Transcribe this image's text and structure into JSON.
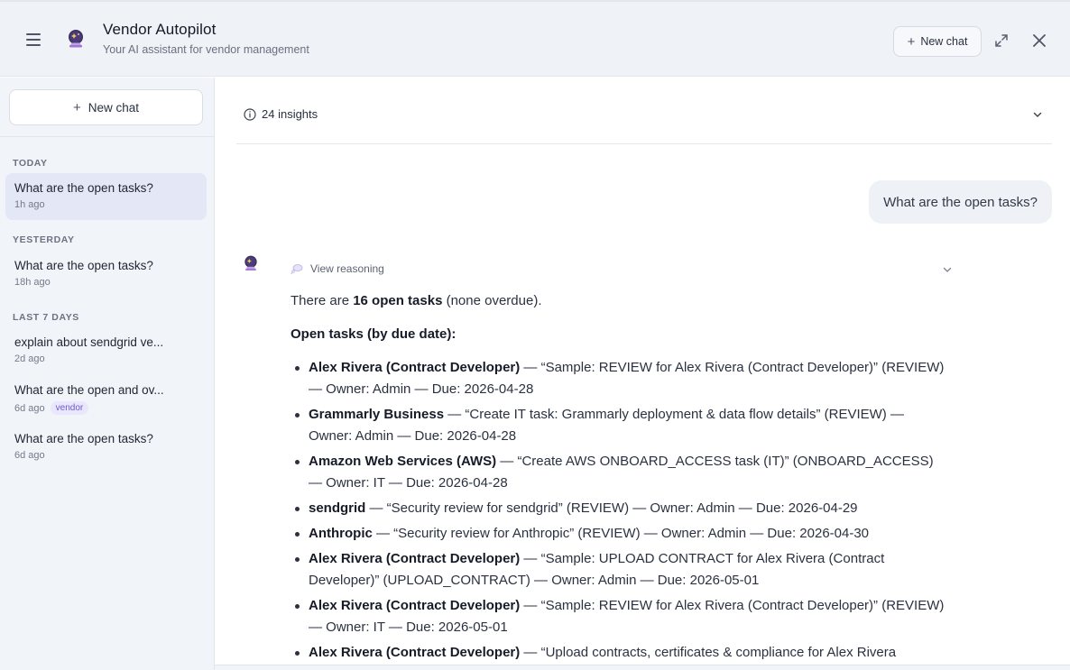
{
  "header": {
    "title": "Vendor Autopilot",
    "subtitle": "Your AI assistant for vendor management",
    "new_chat_label": "New chat"
  },
  "sidebar": {
    "new_chat_label": "New chat",
    "sections": [
      {
        "label": "TODAY"
      },
      {
        "label": "YESTERDAY"
      },
      {
        "label": "LAST 7 DAYS"
      }
    ],
    "conversations": [
      {
        "title": "What are the open tasks?",
        "time": "1h ago",
        "active": true
      },
      {
        "title": "What are the open tasks?",
        "time": "18h ago"
      },
      {
        "title": "explain about sendgrid ve...",
        "time": "2d ago"
      },
      {
        "title": "What are the open and ov...",
        "time": "6d ago",
        "tag": "vendor"
      },
      {
        "title": "What are the open tasks?",
        "time": "6d ago"
      }
    ]
  },
  "main": {
    "insights_label": "24 insights",
    "user_message": "What are the open tasks?",
    "reasoning_label": "View reasoning",
    "answer": {
      "intro_pre": "There are ",
      "intro_bold": "16 open tasks",
      "intro_post": " (none overdue).",
      "heading": "Open tasks (by due date):",
      "tasks": [
        {
          "name": "Alex Rivera (Contract Developer)",
          "detail": " — “Sample: REVIEW for Alex Rivera (Contract Developer)” (REVIEW) — Owner: Admin — Due: 2026-04-28"
        },
        {
          "name": "Grammarly Business",
          "detail": " — “Create IT task: Grammarly deployment & data flow details” (REVIEW) — Owner: Admin — Due: 2026-04-28"
        },
        {
          "name": "Amazon Web Services (AWS)",
          "detail": " — “Create AWS ONBOARD_ACCESS task (IT)” (ONBOARD_ACCESS) — Owner: IT — Due: 2026-04-28"
        },
        {
          "name": "sendgrid",
          "detail": " — “Security review for sendgrid” (REVIEW) — Owner: Admin — Due: 2026-04-29"
        },
        {
          "name": "Anthropic",
          "detail": " — “Security review for Anthropic” (REVIEW) — Owner: Admin — Due: 2026-04-30"
        },
        {
          "name": "Alex Rivera (Contract Developer)",
          "detail": " — “Sample: UPLOAD CONTRACT for Alex Rivera (Contract Developer)” (UPLOAD_CONTRACT) — Owner: Admin — Due: 2026-05-01"
        },
        {
          "name": "Alex Rivera (Contract Developer)",
          "detail": " — “Sample: REVIEW for Alex Rivera (Contract Developer)” (REVIEW) — Owner: IT — Due: 2026-05-01"
        },
        {
          "name": "Alex Rivera (Contract Developer)",
          "detail": " — “Upload contracts, certificates & compliance for Alex Rivera"
        }
      ]
    }
  },
  "colors": {
    "accent": "#6b5bd3",
    "active_conversation_bg": "#e3e7f6",
    "header_bg": "#eff2f7"
  },
  "icons": {
    "menu": "hamburger-icon",
    "assistant": "crystal-ball-icon",
    "plus": "plus-icon",
    "expand": "expand-icon",
    "close": "close-icon",
    "insights": "info-circle-icon",
    "chevron": "chevron-down-icon",
    "reasoning": "thought-bubble-icon"
  }
}
